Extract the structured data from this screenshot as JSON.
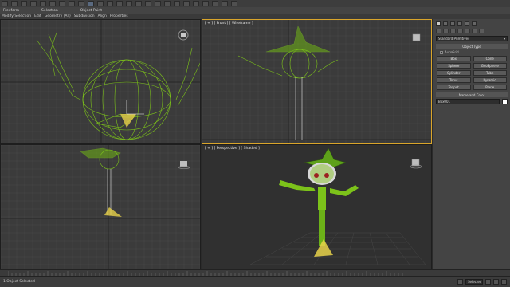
{
  "toolbar": {
    "buttons": [
      "undo",
      "redo",
      "link",
      "unlink",
      "bind",
      "select",
      "select-by-name",
      "rect-region",
      "window-crossing",
      "move",
      "rotate",
      "scale",
      "ref-coord",
      "pivot",
      "snap",
      "angle-snap",
      "percent-snap",
      "spinner-snap",
      "mirror",
      "align",
      "layers",
      "graph",
      "material",
      "render-setup",
      "render"
    ]
  },
  "ribbon": {
    "tabs": [
      "Freeform",
      "Selection",
      "Object Paint"
    ]
  },
  "subbar": {
    "items": [
      "Modify Selection",
      "Edit",
      "Geometry (All)",
      "Subdivision",
      "Align",
      "Properties"
    ]
  },
  "viewports": {
    "top": {
      "label": ""
    },
    "front": {
      "label": "[ + ] [ Front ] [ Wireframe ]"
    },
    "left": {
      "label": ""
    },
    "perspective": {
      "label": "[ + ] [ Perspective ] [ Shaded ]"
    }
  },
  "command_panel": {
    "dropdown": "Standard Primitives",
    "object_type_header": "Object Type",
    "autogrid_label": "AutoGrid",
    "object_buttons": [
      "Box",
      "Cone",
      "Sphere",
      "GeoSphere",
      "Cylinder",
      "Tube",
      "Torus",
      "Pyramid",
      "Teapot",
      "Plane"
    ],
    "name_color_header": "Name and Color",
    "name_value": "Box001"
  },
  "status": {
    "selection_text": "1 Object Selected",
    "field_value": "Selected"
  },
  "colors": {
    "accent_active_viewport": "#d9a52b",
    "wire_green": "#7cc21a",
    "selection_yellow": "#e8d24a"
  }
}
